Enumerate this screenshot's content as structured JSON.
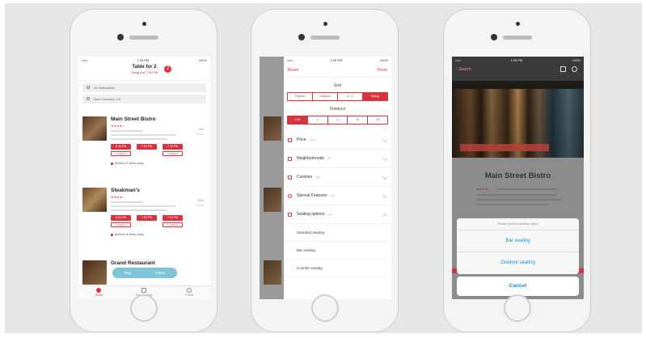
{
  "screen1": {
    "status": {
      "time": "1:25 PM",
      "battery": "100%"
    },
    "header": {
      "title": "Table for 2",
      "subtitle": "Tonight at 7:00 PM",
      "badge": "2"
    },
    "search": {
      "restaurants": "All restaurants",
      "location": "San Francisco, CA"
    },
    "restaurants": [
      {
        "name": "Main Street Bistro",
        "stars": "★★★★☆",
        "price": "$$$",
        "distance": "1.2 mi",
        "slots": [
          "6:45 PM",
          "7:00 PM",
          "7:15 PM"
        ],
        "slot_note": "+1,000 pts",
        "booked": "Booked 47 times today"
      },
      {
        "name": "Steakman's",
        "stars": "★★★★☆",
        "price": "$$$$",
        "distance": "1.5 mi",
        "slots": [
          "6:45 PM",
          "7:00 PM",
          "7:15 PM"
        ],
        "slot_note": "+1,000 pts",
        "booked": "Booked 16 times today"
      },
      {
        "name": "Grand Restaurant"
      }
    ],
    "map_pill": {
      "map": "Map",
      "filters": "Filters"
    },
    "tabs": [
      "Home",
      "Reservations",
      "Profile"
    ]
  },
  "screen2": {
    "status": {
      "time": "1:25 PM",
      "battery": "100%"
    },
    "nav": {
      "reset": "Reset",
      "done": "Done"
    },
    "sort": {
      "label": "Sort",
      "options": [
        "Popular",
        "Distance",
        "A - Z",
        "Rating"
      ],
      "selected": "Rating"
    },
    "distance": {
      "label": "Distance",
      "options": [
        "0.25",
        "1",
        "3",
        "10",
        "25"
      ],
      "selected": "0.25"
    },
    "filters": [
      {
        "label": "Price",
        "count": "(any)"
      },
      {
        "label": "Neighborhoods",
        "count": "(3)"
      },
      {
        "label": "Cuisines",
        "count": "(all)"
      },
      {
        "label": "Special Features",
        "count": "(all)"
      },
      {
        "label": "Seating options",
        "count": "(all)"
      }
    ],
    "seating": [
      "Standard seating",
      "Bar seating",
      "Counter seating"
    ]
  },
  "screen3": {
    "status": {
      "time": "1:25 PM",
      "battery": "100%"
    },
    "back": "Search",
    "name": "Main Street Bistro",
    "stars": "★★★★☆",
    "sheet": {
      "title": "Please select a seating option",
      "options": [
        "Bar seating",
        "Outdoor seating"
      ],
      "cancel": "Cancel"
    }
  },
  "colors": {
    "accent": "#d9333f",
    "action": "#1a8ed1"
  }
}
